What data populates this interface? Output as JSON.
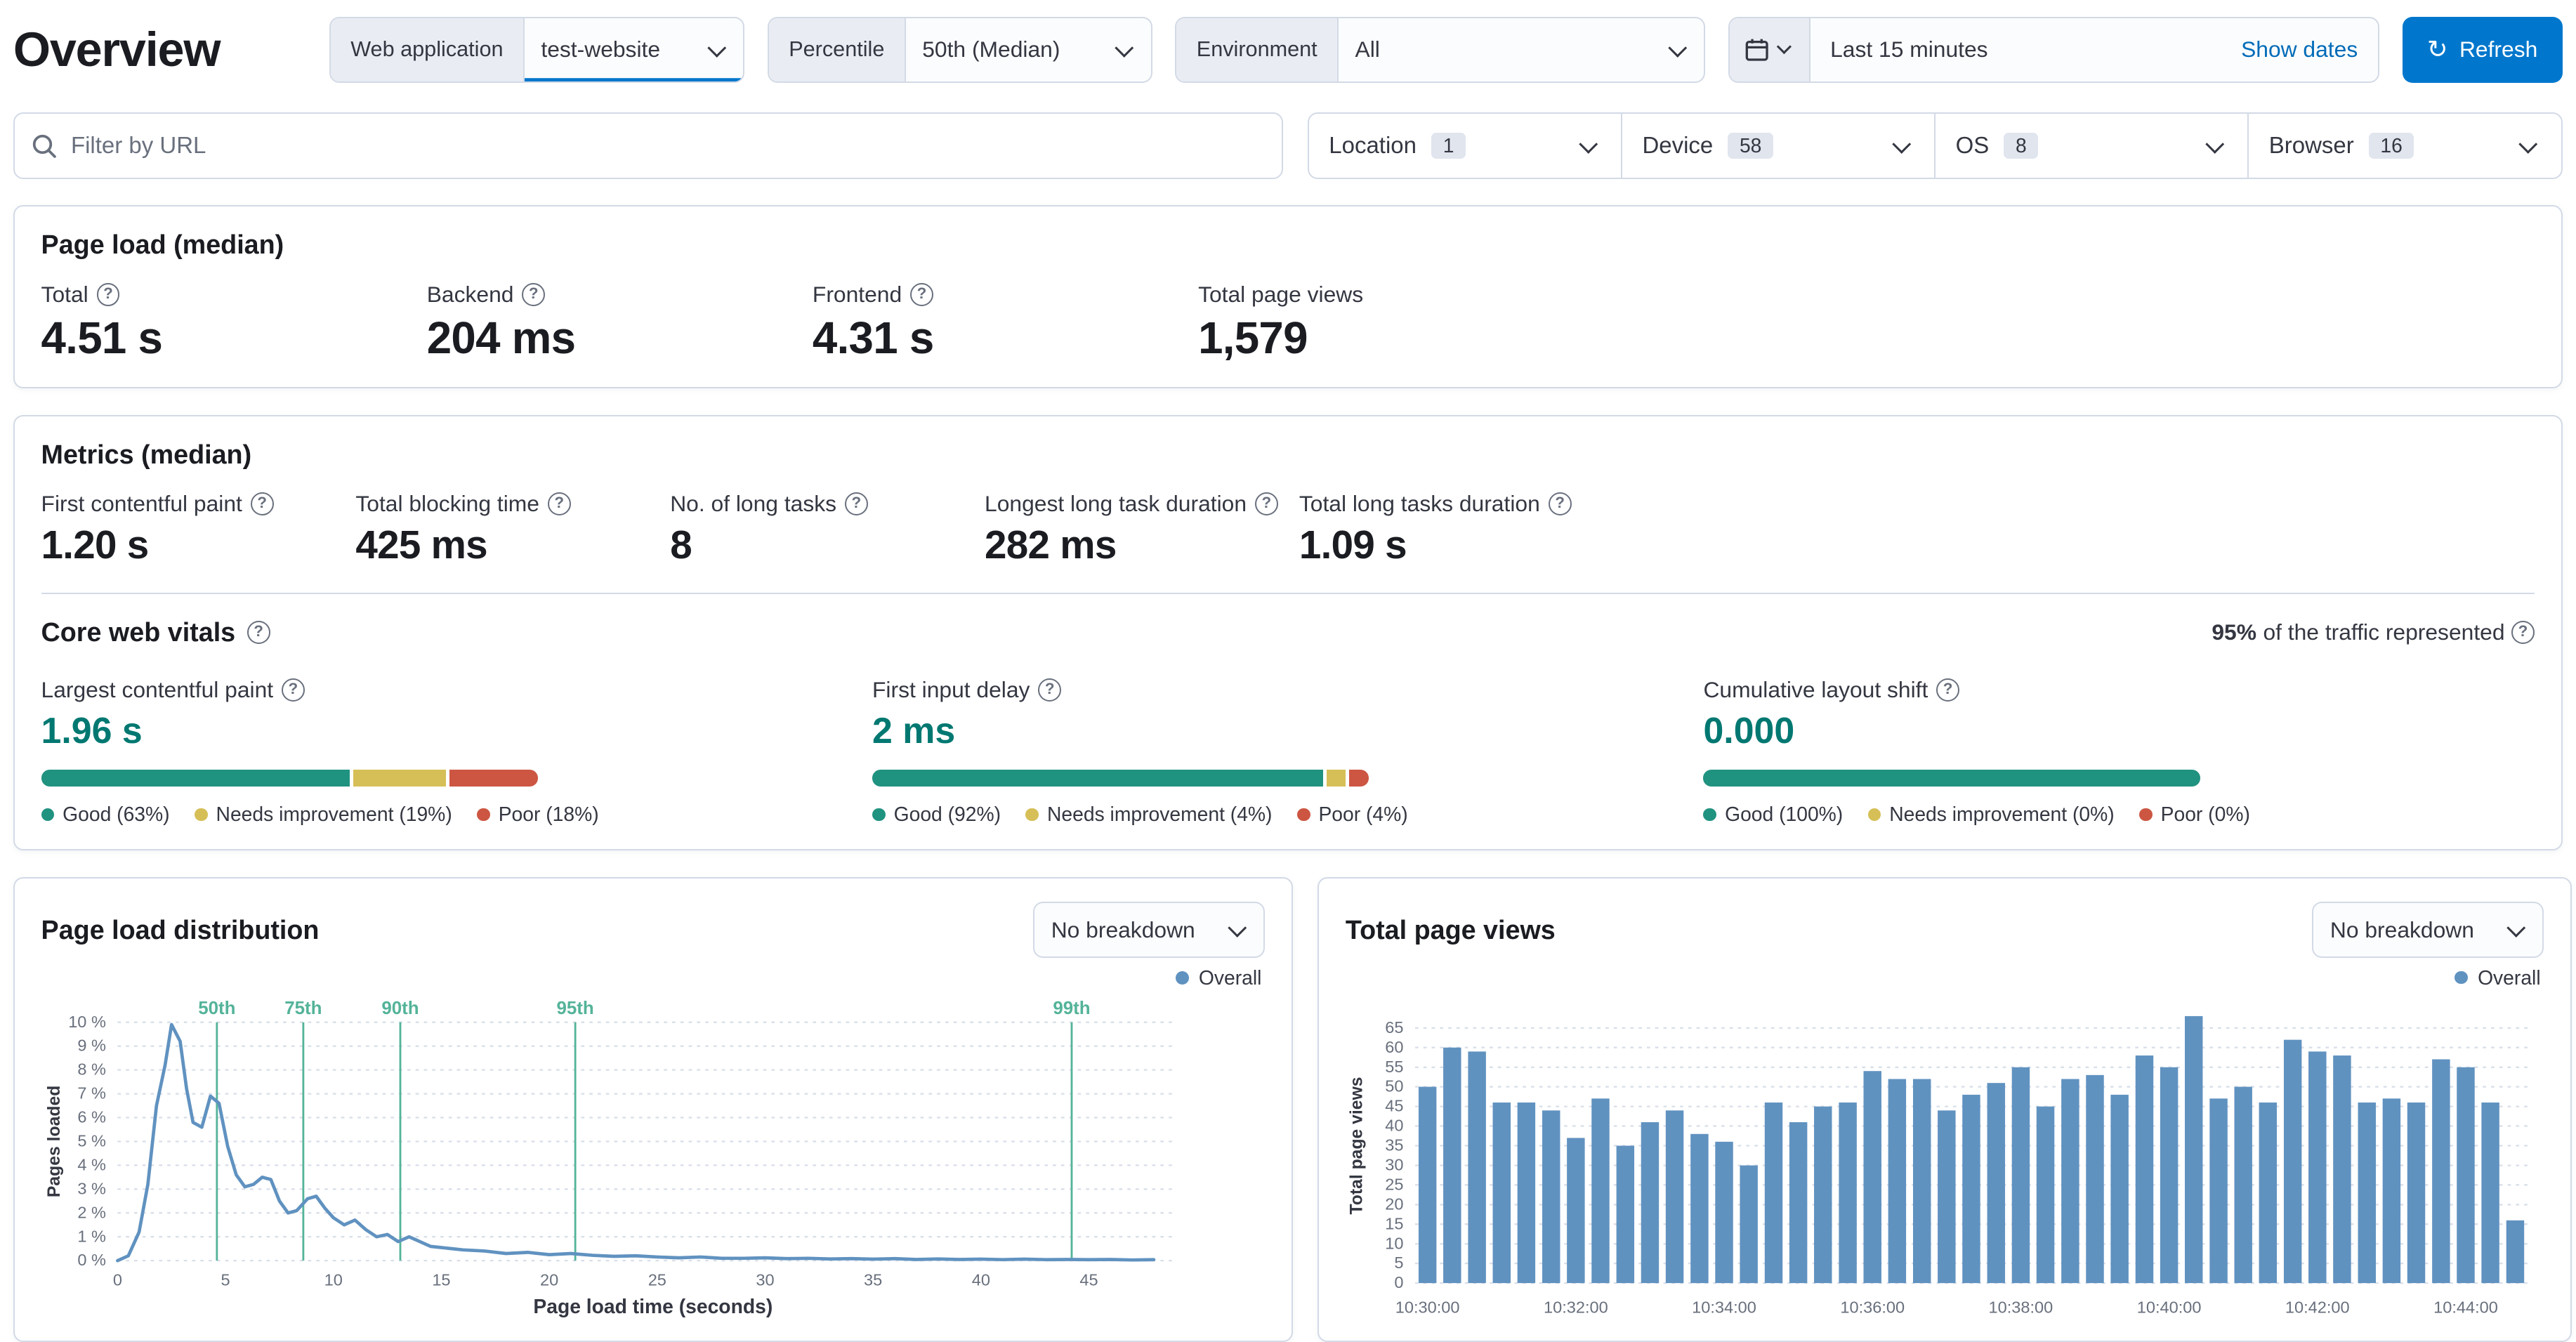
{
  "page": {
    "title": "Overview"
  },
  "icons": {
    "help": "?",
    "refresh": "↻",
    "search": "magnifier-icon",
    "calendar": "calendar-icon",
    "chevron": "chevron-down-icon"
  },
  "controls": {
    "web_app": {
      "label": "Web application",
      "value": "test-website"
    },
    "percentile": {
      "label": "Percentile",
      "value": "50th (Median)"
    },
    "environment": {
      "label": "Environment",
      "value": "All"
    },
    "time": {
      "range": "Last 15 minutes",
      "show_dates": "Show dates",
      "refresh": "Refresh"
    }
  },
  "filters": {
    "url_placeholder": "Filter by URL",
    "items": [
      {
        "label": "Location",
        "count": "1"
      },
      {
        "label": "Device",
        "count": "58"
      },
      {
        "label": "OS",
        "count": "8"
      },
      {
        "label": "Browser",
        "count": "16"
      }
    ]
  },
  "page_load": {
    "title": "Page load (median)",
    "stats": [
      {
        "label": "Total",
        "value": "4.51 s"
      },
      {
        "label": "Backend",
        "value": "204 ms"
      },
      {
        "label": "Frontend",
        "value": "4.31 s"
      },
      {
        "label": "Total page views",
        "value": "1,579"
      }
    ]
  },
  "metrics": {
    "title": "Metrics (median)",
    "stats": [
      {
        "label": "First contentful paint",
        "value": "1.20 s"
      },
      {
        "label": "Total blocking time",
        "value": "425 ms"
      },
      {
        "label": "No. of long tasks",
        "value": "8"
      },
      {
        "label": "Longest long task duration",
        "value": "282 ms"
      },
      {
        "label": "Total long tasks duration",
        "value": "1.09 s"
      }
    ]
  },
  "core_web_vitals": {
    "title": "Core web vitals",
    "traffic_percent": "95%",
    "traffic_suffix": " of the traffic represented",
    "colors": {
      "good": "#209280",
      "needs_improvement": "#d6bf57",
      "poor": "#cc5642",
      "value_text": "#007871"
    },
    "vitals": [
      {
        "label": "Largest contentful paint",
        "value": "1.96 s",
        "segments": [
          63,
          19,
          18
        ],
        "legend": [
          "Good (63%)",
          "Needs improvement (19%)",
          "Poor (18%)"
        ]
      },
      {
        "label": "First input delay",
        "value": "2 ms",
        "segments": [
          92,
          4,
          4
        ],
        "legend": [
          "Good (92%)",
          "Needs improvement (4%)",
          "Poor (4%)"
        ]
      },
      {
        "label": "Cumulative layout shift",
        "value": "0.000",
        "segments": [
          100,
          0,
          0
        ],
        "legend": [
          "Good (100%)",
          "Needs improvement (0%)",
          "Poor (0%)"
        ]
      }
    ]
  },
  "chart_data": [
    {
      "type": "line",
      "title": "Page load distribution",
      "breakdown": "No breakdown",
      "legend": [
        "Overall"
      ],
      "series_color": "#6092c0",
      "marker_color": "#54b399",
      "xlabel": "Page load time (seconds)",
      "ylabel": "Pages loaded",
      "xlim": [
        0,
        49
      ],
      "ylim": [
        0,
        10
      ],
      "x_ticks": [
        0,
        5,
        10,
        15,
        20,
        25,
        30,
        35,
        40,
        45
      ],
      "y_tick_suffix": " %",
      "grid": "horizontal-dotted",
      "legend_position": "top-right",
      "percentile_markers": [
        {
          "label": "50th",
          "x": 4.6
        },
        {
          "label": "75th",
          "x": 8.6
        },
        {
          "label": "90th",
          "x": 13.1
        },
        {
          "label": "95th",
          "x": 21.2
        },
        {
          "label": "99th",
          "x": 44.2
        }
      ],
      "points": [
        [
          0,
          0
        ],
        [
          0.5,
          0.2
        ],
        [
          1,
          1.2
        ],
        [
          1.4,
          3.2
        ],
        [
          1.8,
          6.5
        ],
        [
          2.2,
          8.2
        ],
        [
          2.5,
          9.9
        ],
        [
          2.9,
          9.2
        ],
        [
          3.2,
          7.2
        ],
        [
          3.5,
          5.8
        ],
        [
          3.9,
          5.6
        ],
        [
          4.3,
          6.9
        ],
        [
          4.7,
          6.6
        ],
        [
          5.1,
          4.8
        ],
        [
          5.5,
          3.6
        ],
        [
          5.9,
          3.1
        ],
        [
          6.3,
          3.2
        ],
        [
          6.7,
          3.5
        ],
        [
          7.1,
          3.4
        ],
        [
          7.5,
          2.5
        ],
        [
          7.9,
          2.0
        ],
        [
          8.3,
          2.1
        ],
        [
          8.8,
          2.6
        ],
        [
          9.2,
          2.7
        ],
        [
          9.6,
          2.2
        ],
        [
          10,
          1.8
        ],
        [
          10.5,
          1.5
        ],
        [
          11,
          1.7
        ],
        [
          11.5,
          1.3
        ],
        [
          12,
          1.0
        ],
        [
          12.5,
          1.1
        ],
        [
          13,
          0.8
        ],
        [
          13.5,
          1.0
        ],
        [
          14,
          0.8
        ],
        [
          14.5,
          0.6
        ],
        [
          15,
          0.55
        ],
        [
          15.5,
          0.5
        ],
        [
          16,
          0.45
        ],
        [
          17,
          0.4
        ],
        [
          18,
          0.3
        ],
        [
          19,
          0.35
        ],
        [
          20,
          0.25
        ],
        [
          21,
          0.3
        ],
        [
          22,
          0.22
        ],
        [
          23,
          0.18
        ],
        [
          24,
          0.2
        ],
        [
          25,
          0.15
        ],
        [
          26,
          0.12
        ],
        [
          27,
          0.15
        ],
        [
          28,
          0.1
        ],
        [
          29,
          0.1
        ],
        [
          30,
          0.12
        ],
        [
          31,
          0.08
        ],
        [
          32,
          0.1
        ],
        [
          33,
          0.07
        ],
        [
          34,
          0.08
        ],
        [
          35,
          0.06
        ],
        [
          36,
          0.08
        ],
        [
          37,
          0.05
        ],
        [
          38,
          0.07
        ],
        [
          39,
          0.05
        ],
        [
          40,
          0.06
        ],
        [
          41,
          0.04
        ],
        [
          42,
          0.06
        ],
        [
          43,
          0.04
        ],
        [
          44,
          0.05
        ],
        [
          45,
          0.04
        ],
        [
          46,
          0.05
        ],
        [
          47,
          0.03
        ],
        [
          48,
          0.04
        ]
      ]
    },
    {
      "type": "bar",
      "title": "Total page views",
      "breakdown": "No breakdown",
      "legend": [
        "Overall"
      ],
      "bar_color": "#6092c0",
      "ylabel": "Total page views",
      "ylim": [
        0,
        70
      ],
      "y_ticks": [
        0,
        5,
        10,
        15,
        20,
        25,
        30,
        35,
        40,
        45,
        50,
        55,
        60,
        65
      ],
      "grid": "horizontal-dotted",
      "legend_position": "top-right",
      "bucket_seconds": 20,
      "x_tick_labels": [
        "10:30:00",
        "10:32:00",
        "10:34:00",
        "10:36:00",
        "10:38:00",
        "10:40:00",
        "10:42:00",
        "10:44:00"
      ],
      "x_tick_indices": [
        0,
        6,
        12,
        18,
        24,
        30,
        36,
        42
      ],
      "values": [
        50,
        60,
        59,
        46,
        46,
        44,
        37,
        47,
        35,
        41,
        44,
        38,
        36,
        30,
        46,
        41,
        45,
        46,
        54,
        52,
        52,
        44,
        48,
        51,
        55,
        45,
        52,
        53,
        48,
        58,
        55,
        68,
        47,
        50,
        46,
        62,
        59,
        58,
        46,
        47,
        46,
        57,
        55,
        46,
        16
      ]
    }
  ]
}
